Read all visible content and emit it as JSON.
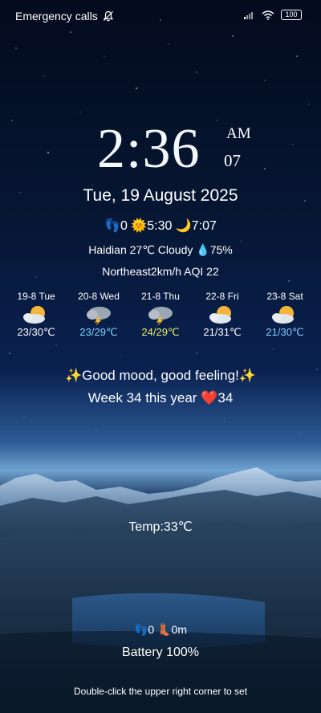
{
  "status_bar": {
    "carrier_text": "Emergency calls",
    "battery_level": "100",
    "icons": [
      "notifications-off-icon",
      "signal-icon",
      "wifi-icon",
      "battery-icon"
    ]
  },
  "clock": {
    "time": "2:36",
    "ampm": "AM",
    "seconds": "07"
  },
  "date": "Tue, 19 August 2025",
  "sun_line": {
    "steps": "0",
    "sunrise": "5:30",
    "sunset": "7:07"
  },
  "weather": {
    "line1": "Haidian 27℃ Cloudy ",
    "humidity": "75%",
    "line2": "Northeast2km/h AQI 22"
  },
  "forecast": [
    {
      "day": "19-8 Tue",
      "temp": "23/30℃",
      "color": "#ffffff",
      "icon": "partly-cloudy-icon"
    },
    {
      "day": "20-8 Wed",
      "temp": "23/29℃",
      "color": "#7ad3ff",
      "icon": "thunderstorm-icon"
    },
    {
      "day": "21-8 Thu",
      "temp": "24/29℃",
      "color": "#e6f06a",
      "icon": "thunderstorm-icon"
    },
    {
      "day": "22-8 Fri",
      "temp": "21/31℃",
      "color": "#ffffff",
      "icon": "partly-cloudy-icon"
    },
    {
      "day": "23-8 Sat",
      "temp": "21/30℃",
      "color": "#7ad3ff",
      "icon": "partly-cloudy-icon"
    }
  ],
  "mood": "✨Good mood, good feeling!✨",
  "week": {
    "text": "Week 34 this year ",
    "count": "34"
  },
  "temperature": "Temp:33℃",
  "steps_line": {
    "steps": "0",
    "distance": "0m"
  },
  "battery_text": "Battery 100%",
  "hint": "Double-click the upper right corner to set"
}
